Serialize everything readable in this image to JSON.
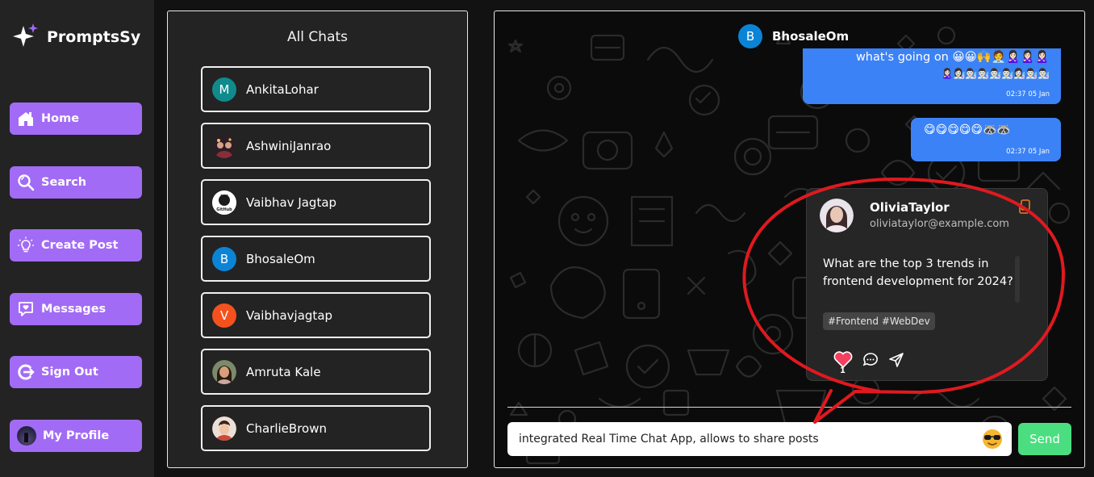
{
  "app": {
    "name": "PromptsSy"
  },
  "sidebar": {
    "items": [
      {
        "label": "Home",
        "icon": "home-icon"
      },
      {
        "label": "Search",
        "icon": "search-icon"
      },
      {
        "label": "Create Post",
        "icon": "lightbulb-icon"
      },
      {
        "label": "Messages",
        "icon": "message-heart-icon"
      },
      {
        "label": "Sign Out",
        "icon": "sign-out-icon"
      },
      {
        "label": "My Profile",
        "icon": "avatar"
      }
    ]
  },
  "chats": {
    "title": "All Chats",
    "items": [
      {
        "name": "AnkitaLohar",
        "initial": "M",
        "color": "#0f8b8d"
      },
      {
        "name": "AshwiniJanrao",
        "initial": "",
        "color": "#3a2a2a"
      },
      {
        "name": "Vaibhav Jagtap",
        "initial": "",
        "color": "#ffffff"
      },
      {
        "name": "BhosaleOm",
        "initial": "B",
        "color": "#0b84d6"
      },
      {
        "name": "Vaibhavjagtap",
        "initial": "V",
        "color": "#f4511e"
      },
      {
        "name": "Amruta Kale",
        "initial": "",
        "color": "#c58a55"
      },
      {
        "name": "CharlieBrown",
        "initial": "",
        "color": "#e6d6cf"
      }
    ],
    "github_badge": "GitHub"
  },
  "conversation": {
    "contact": {
      "name": "BhosaleOm",
      "initial": "B",
      "color": "#0b84d6"
    },
    "messages": [
      {
        "line1": "what's going on 😀😀🙌🧑‍💼🙎🏻‍♀️🙎🏻‍♀️🙎🏻‍♀️",
        "line2": "🙎🏻‍♀️👩🏻‍🔬👨🏻‍🔬👨🏻‍🔬👨🏻‍🔬👨🏻‍🔬👩🏻‍🔬👨🏻‍🔬👨🏻‍🔬",
        "time": "02:37 05 Jan"
      },
      {
        "line1": "😋😋😋😋😋🦝🦝",
        "time": "02:37 05 Jan"
      }
    ],
    "shared_post": {
      "author": "OliviaTaylor",
      "email": "oliviataylor@example.com",
      "text": "What are the top 3 trends in frontend development for 2024?",
      "tags": "#Frontend #WebDev",
      "likes": "1"
    },
    "input": {
      "value": "integrated Real Time Chat App, allows to share posts",
      "placeholder": ""
    },
    "send_label": "Send"
  },
  "colors": {
    "accent": "#a26bf5",
    "bubble": "#3b82f6",
    "send": "#4ade80",
    "annotation": "#e0191f"
  }
}
